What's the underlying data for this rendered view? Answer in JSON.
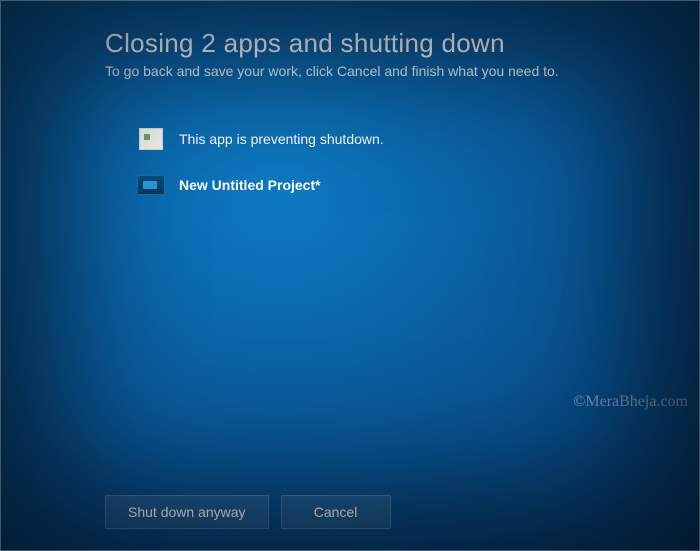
{
  "header": {
    "title": "Closing 2 apps and shutting down",
    "subtitle": "To go back and save your work, click Cancel and finish what you need to."
  },
  "apps": [
    {
      "icon": "generic-app-icon",
      "label": "This app is preventing shutdown.",
      "bold": false
    },
    {
      "icon": "video-editor-icon",
      "label": "New Untitled Project*",
      "bold": true
    }
  ],
  "buttons": {
    "shutdown": "Shut down anyway",
    "cancel": "Cancel"
  },
  "watermark": "©MeraBheja.com"
}
